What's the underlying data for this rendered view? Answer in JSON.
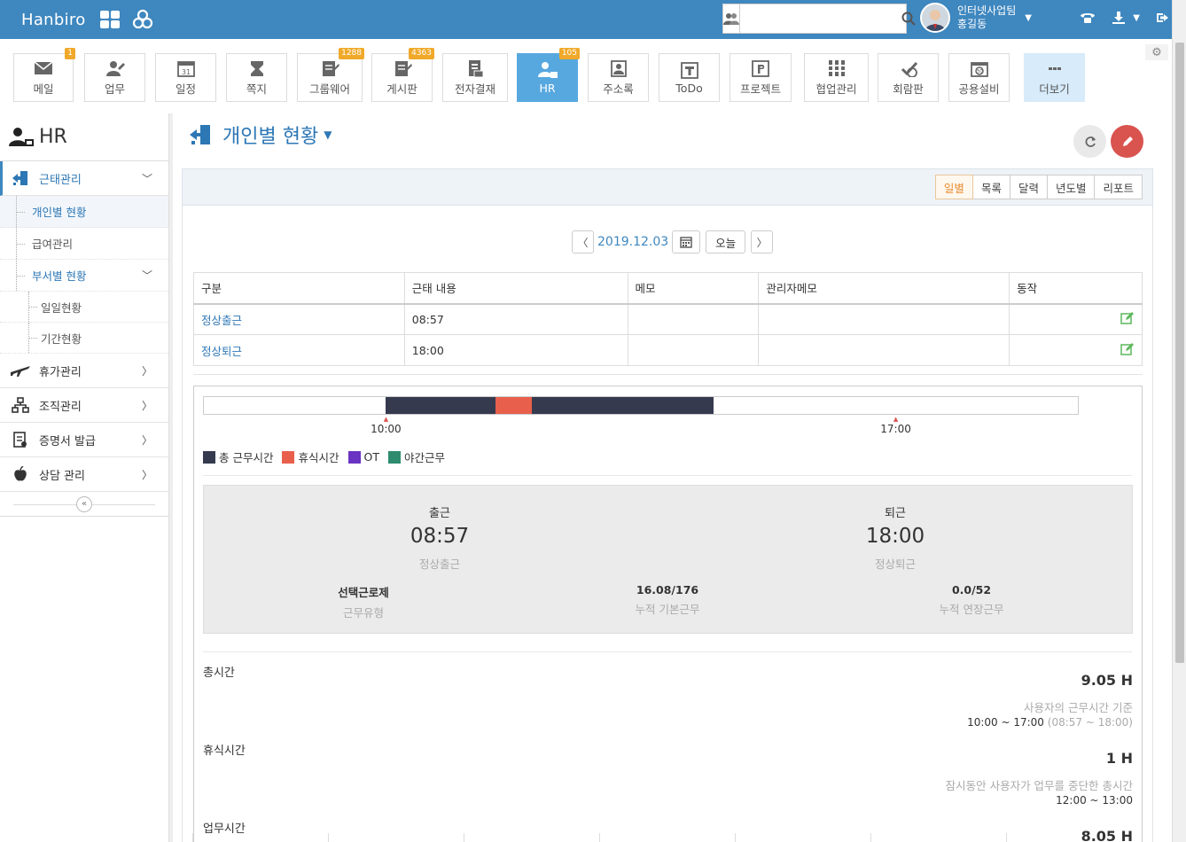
{
  "header": {
    "brand": "Hanbiro",
    "search_placeholder": "",
    "user_team": "인터넷사업팀",
    "user_name": "홍길동"
  },
  "apps": [
    {
      "label": "메일",
      "badge": "1",
      "icon": "mail-icon"
    },
    {
      "label": "업무",
      "badge": "",
      "icon": "task-icon"
    },
    {
      "label": "일정",
      "badge": "",
      "icon": "calendar-icon"
    },
    {
      "label": "쪽지",
      "badge": "",
      "icon": "note-icon"
    },
    {
      "label": "그룹웨어",
      "badge": "1288",
      "icon": "groupware-icon"
    },
    {
      "label": "게시판",
      "badge": "4363",
      "icon": "board-icon"
    },
    {
      "label": "전자결재",
      "badge": "",
      "icon": "approval-icon"
    },
    {
      "label": "HR",
      "badge": "105",
      "icon": "hr-icon"
    },
    {
      "label": "주소록",
      "badge": "",
      "icon": "addressbook-icon"
    },
    {
      "label": "ToDo",
      "badge": "",
      "icon": "todo-icon"
    },
    {
      "label": "프로젝트",
      "badge": "",
      "icon": "project-icon"
    },
    {
      "label": "협업관리",
      "badge": "",
      "icon": "collab-icon"
    },
    {
      "label": "회람판",
      "badge": "",
      "icon": "circular-icon"
    },
    {
      "label": "공용설비",
      "badge": "",
      "icon": "facility-icon"
    },
    {
      "label": "더보기",
      "badge": "",
      "icon": "more-icon"
    }
  ],
  "sidebar": {
    "title": "HR",
    "attendance": "근태관리",
    "personal_status": "개인별 현황",
    "payroll": "급여관리",
    "dept_status": "부서별 현황",
    "daily_status": "일일현황",
    "period_status": "기간현황",
    "leave": "휴가관리",
    "org": "조직관리",
    "certificate": "증명서 발급",
    "counsel": "상담 관리"
  },
  "page": {
    "title": "개인별 현황"
  },
  "view_tabs": [
    "일별",
    "목록",
    "달력",
    "년도별",
    "리포트"
  ],
  "date_nav": {
    "date": "2019.12.03",
    "today": "오늘"
  },
  "table": {
    "headers": [
      "구분",
      "근태 내용",
      "메모",
      "관리자메모",
      "동작"
    ],
    "rows": [
      {
        "type": "정상출근",
        "content": "08:57",
        "memo": "",
        "admin_memo": ""
      },
      {
        "type": "정상퇴근",
        "content": "18:00",
        "memo": "",
        "admin_memo": ""
      }
    ]
  },
  "timeline": {
    "range_start_hour": 7.5,
    "range_end_hour": 19.5,
    "work_start": 10.0,
    "work_end": 14.5,
    "rest_start": 11.5,
    "rest_end": 12.0,
    "marks": [
      "10:00",
      "17:00"
    ],
    "mark_hours": [
      10.0,
      17.0
    ],
    "colors": {
      "total": "#363a4f",
      "rest": "#e8604c",
      "ot": "#6a33c2",
      "night": "#2e8b6e"
    }
  },
  "legend": [
    "총 근무시간",
    "휴식시간",
    "OT",
    "야간근무"
  ],
  "summary": {
    "in_label": "출근",
    "in_time": "08:57",
    "in_status": "정상출근",
    "out_label": "퇴근",
    "out_time": "18:00",
    "out_status": "정상퇴근",
    "work_type": "선택근로제",
    "work_type_label": "근무유형",
    "basic": "16.08/176",
    "basic_label": "누적 기본근무",
    "overtime": "0.0/52",
    "overtime_label": "누적 연장근무"
  },
  "details": {
    "total_label": "총시간",
    "total_value": "9.05 H",
    "total_desc": "사용자의 근무시간 기준",
    "total_range": "10:00 ~ 17:00",
    "total_range_note": "(08:57 ~ 18:00)",
    "rest_label": "휴식시간",
    "rest_value": "1 H",
    "rest_desc": "잠시동안 사용자가 업무를 중단한 총시간",
    "rest_range": "12:00 ~ 13:00",
    "work_label": "업무시간",
    "work_value": "8.05 H"
  }
}
